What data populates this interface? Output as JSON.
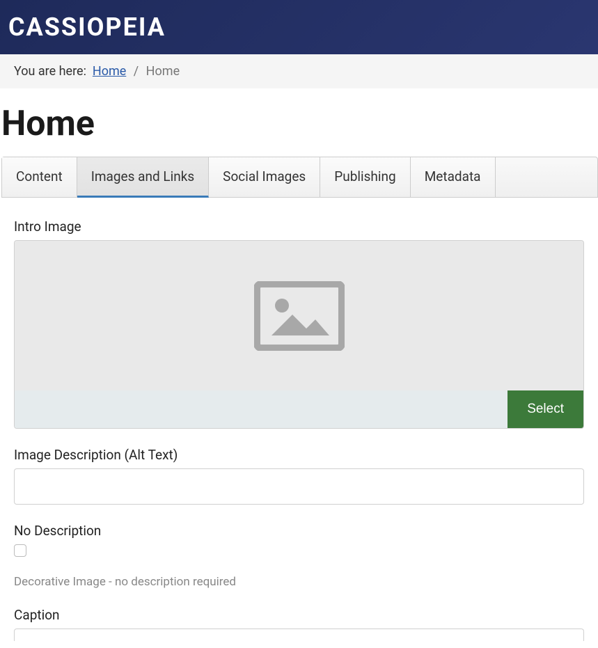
{
  "header": {
    "logo": "CASSIOPEIA"
  },
  "breadcrumb": {
    "prefix": "You are here:",
    "home_link": "Home",
    "separator": "/",
    "current": "Home"
  },
  "page": {
    "title": "Home"
  },
  "tabs": {
    "content": "Content",
    "images_links": "Images and Links",
    "social": "Social Images",
    "publishing": "Publishing",
    "metadata": "Metadata"
  },
  "form": {
    "intro_image_label": "Intro Image",
    "select_button": "Select",
    "alt_label": "Image Description (Alt Text)",
    "alt_value": "",
    "no_desc_label": "No Description",
    "no_desc_hint": "Decorative Image - no description required",
    "caption_label": "Caption"
  }
}
